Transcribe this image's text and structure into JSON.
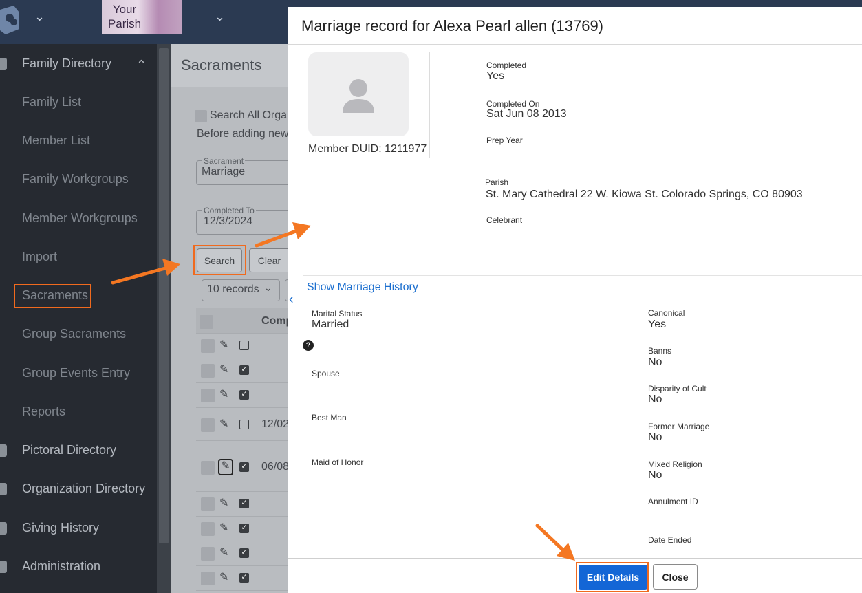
{
  "topbar": {
    "parish_logo_text": "Your Parish",
    "chevron_glyph": "⌄"
  },
  "sidebar": {
    "items": [
      {
        "label": "Family Directory",
        "icon": "family-icon"
      },
      {
        "label": "Family List"
      },
      {
        "label": "Member List"
      },
      {
        "label": "Family Workgroups"
      },
      {
        "label": "Member Workgroups"
      },
      {
        "label": "Import"
      },
      {
        "label": "Sacraments"
      },
      {
        "label": "Group Sacraments"
      },
      {
        "label": "Group Events Entry"
      },
      {
        "label": "Reports"
      },
      {
        "label": "Pictoral Directory",
        "icon": "directory-icon"
      },
      {
        "label": "Organization Directory",
        "icon": "org-icon"
      },
      {
        "label": "Giving History",
        "icon": "giving-icon"
      },
      {
        "label": "Administration",
        "icon": "gear-icon"
      }
    ],
    "expand_glyph": "⌃"
  },
  "background_page": {
    "title": "Sacraments",
    "search_all_label": "Search All Orga",
    "before_adding_text": "Before adding new",
    "sacrament_label": "Sacrament",
    "sacrament_value": "Marriage",
    "completed_to_label": "Completed To",
    "completed_to_value": "12/3/2024",
    "search_button": "Search",
    "clear_button": "Clear",
    "records_select": "10 records",
    "column_header": "Comp",
    "row_dates": [
      "12/02",
      "06/08"
    ]
  },
  "modal": {
    "title": "Marriage record for Alexa Pearl allen (13769)",
    "member_duid": "Member DUID: 1211977",
    "completed_label": "Completed",
    "completed_value": "Yes",
    "completed_on_label": "Completed On",
    "completed_on_value": "Sat Jun 08 2013",
    "prep_year_label": "Prep Year",
    "parish_label": "Parish",
    "parish_value": "St. Mary Cathedral 22 W. Kiowa St. Colorado Springs, CO 80903",
    "celebrant_label": "Celebrant",
    "show_history_link": "Show Marriage History",
    "marital_status_label": "Marital Status",
    "marital_status_value": "Married",
    "help_glyph": "?",
    "spouse_label": "Spouse",
    "best_man_label": "Best Man",
    "maid_of_honor_label": "Maid of Honor",
    "canonical_label": "Canonical",
    "canonical_value": "Yes",
    "banns_label": "Banns",
    "banns_value": "No",
    "disparity_label": "Disparity of Cult",
    "disparity_value": "No",
    "former_marriage_label": "Former Marriage",
    "former_marriage_value": "No",
    "mixed_religion_label": "Mixed Religion",
    "mixed_religion_value": "No",
    "annulment_label": "Annulment ID",
    "date_ended_label": "Date Ended",
    "edit_button": "Edit Details",
    "close_button": "Close"
  },
  "colors": {
    "highlight": "#f06a1e",
    "primary_button": "#1366d6",
    "link": "#1c6fcf",
    "sidebar_bg": "#262a31",
    "topbar_bg": "#2b3a52"
  }
}
